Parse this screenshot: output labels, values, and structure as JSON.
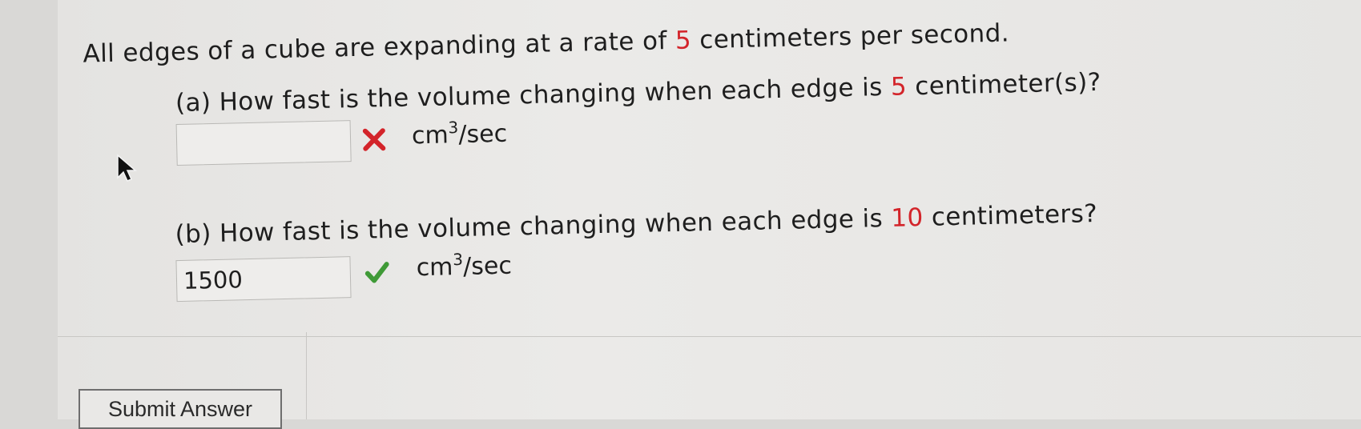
{
  "question": {
    "intro_prefix": "All edges of a cube are expanding at a rate of ",
    "intro_value": "5",
    "intro_suffix": " centimeters per second.",
    "a_prefix": "(a) How fast is the volume changing when each edge is ",
    "a_value": "5",
    "a_suffix": " centimeter(s)?",
    "b_prefix": "(b) How fast is the volume changing when each edge is ",
    "b_value": "10",
    "b_suffix": " centimeters?"
  },
  "answers": {
    "a_value": "",
    "a_status": "incorrect",
    "b_value": "1500",
    "b_status": "correct"
  },
  "units": {
    "base": "cm",
    "exponent": "3",
    "rate": "/sec"
  },
  "buttons": {
    "submit_label": "Submit Answer"
  },
  "colors": {
    "highlight_red": "#d3242a",
    "correct_green": "#3f9a37",
    "incorrect_red": "#d3242a"
  },
  "icons": {
    "incorrect": "x-mark-icon",
    "correct": "check-mark-icon",
    "cursor": "mouse-pointer-icon"
  }
}
